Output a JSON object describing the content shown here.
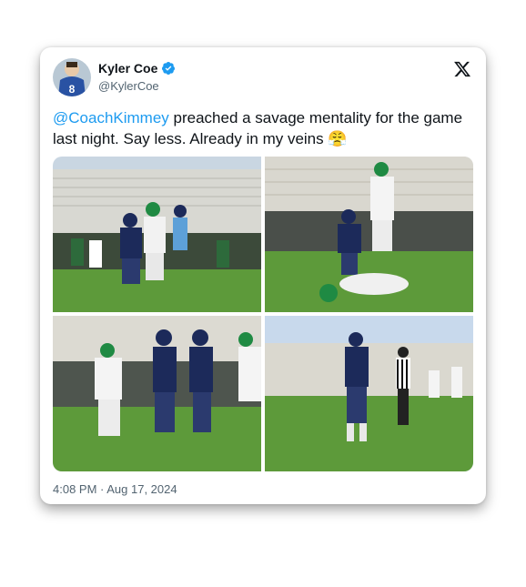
{
  "tweet": {
    "author": {
      "display_name": "Kyler Coe",
      "handle": "@KylerCoe",
      "verified": true,
      "avatar_jersey_number": "8"
    },
    "text": {
      "mention": "@CoachKimmey",
      "body": " preached a savage mentality for the game last night. Say less. Already in my veins ",
      "emoji": "😤"
    },
    "timestamp": "4:08 PM · Aug 17, 2024"
  },
  "icons": {
    "verified": "verified-badge-icon",
    "platform_logo": "x-logo-icon"
  },
  "colors": {
    "mention": "#1d9bf0",
    "verified": "#1d9bf0",
    "text": "#0f1419",
    "muted": "#536471",
    "navy_jersey": "#1c2a5a",
    "green_helmet": "#1f8a43",
    "field_grass": "#5d9a3a"
  },
  "photos": [
    {
      "alt": "football players blocking at line of scrimmage"
    },
    {
      "alt": "player in navy jersey 8 over a fallen player"
    },
    {
      "alt": "player 8 engaging opponent number 64"
    },
    {
      "alt": "player 8 walking on field near referee"
    }
  ]
}
